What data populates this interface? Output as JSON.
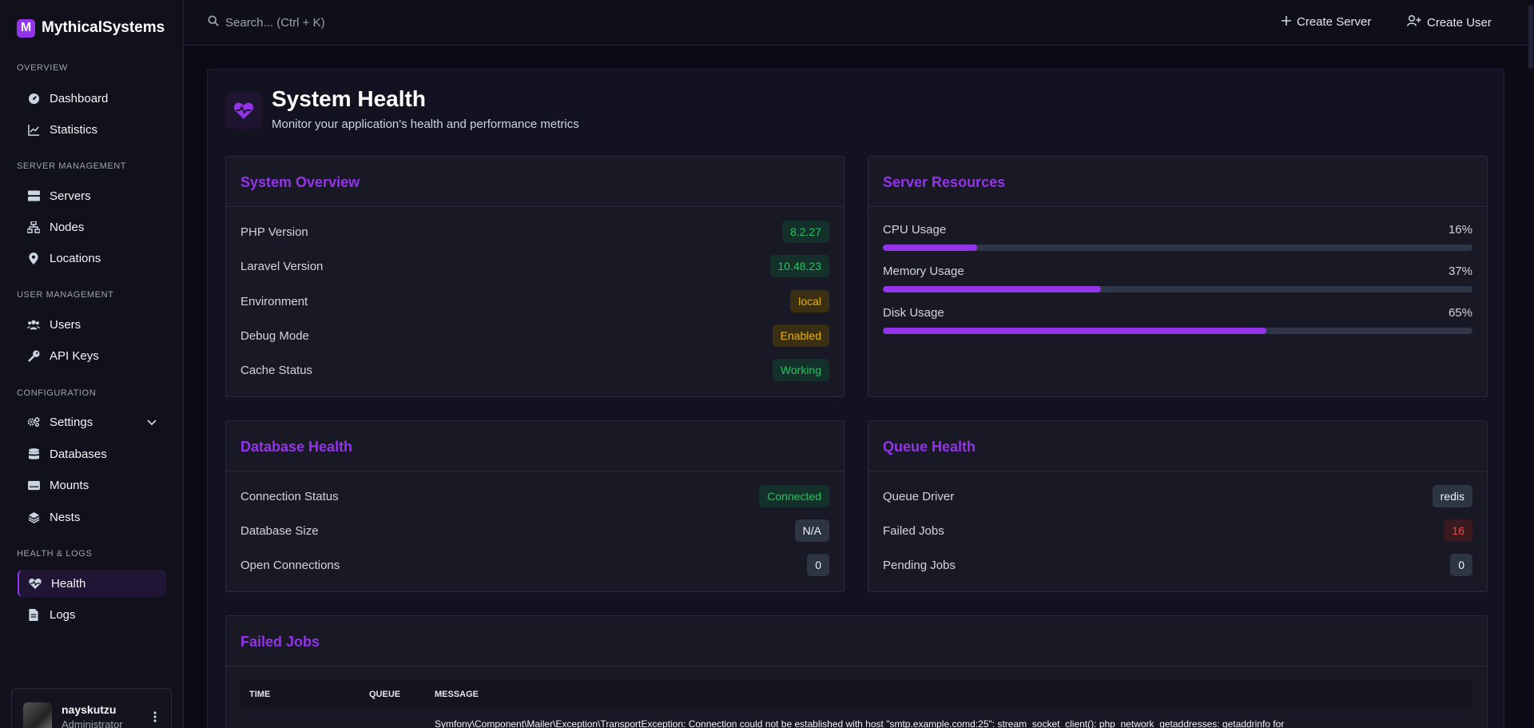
{
  "brand": {
    "logo_letter": "M",
    "name": "MythicalSystems",
    "accent": "#9333ea"
  },
  "sidebar": {
    "sections": [
      {
        "title": "OVERVIEW",
        "items": [
          {
            "label": "Dashboard",
            "icon": "dashboard-icon"
          },
          {
            "label": "Statistics",
            "icon": "chart-line-icon"
          }
        ]
      },
      {
        "title": "SERVER MANAGEMENT",
        "items": [
          {
            "label": "Servers",
            "icon": "server-icon"
          },
          {
            "label": "Nodes",
            "icon": "network-icon"
          },
          {
            "label": "Locations",
            "icon": "map-pin-icon"
          }
        ]
      },
      {
        "title": "USER MANAGEMENT",
        "items": [
          {
            "label": "Users",
            "icon": "users-icon"
          },
          {
            "label": "API Keys",
            "icon": "key-icon"
          }
        ]
      },
      {
        "title": "CONFIGURATION",
        "items": [
          {
            "label": "Settings",
            "icon": "gears-icon"
          },
          {
            "label": "Databases",
            "icon": "database-icon"
          },
          {
            "label": "Mounts",
            "icon": "hard-drive-icon"
          },
          {
            "label": "Nests",
            "icon": "layers-icon"
          }
        ]
      },
      {
        "title": "HEALTH & LOGS",
        "items": [
          {
            "label": "Health",
            "icon": "heart-pulse-icon",
            "active": true
          },
          {
            "label": "Logs",
            "icon": "file-icon"
          }
        ]
      }
    ]
  },
  "user": {
    "name": "nayskutzu",
    "role": "Administrator"
  },
  "topbar": {
    "search_placeholder": "Search... (Ctrl + K)",
    "create_server": "Create Server",
    "create_user": "Create User"
  },
  "page": {
    "title": "System Health",
    "subtitle": "Monitor your application's health and performance metrics"
  },
  "system_overview": {
    "title": "System Overview",
    "rows": [
      {
        "label": "PHP Version",
        "value": "8.2.27",
        "color": "green"
      },
      {
        "label": "Laravel Version",
        "value": "10.48.23",
        "color": "green"
      },
      {
        "label": "Environment",
        "value": "local",
        "color": "yellow"
      },
      {
        "label": "Debug Mode",
        "value": "Enabled",
        "color": "yellow"
      },
      {
        "label": "Cache Status",
        "value": "Working",
        "color": "green"
      }
    ]
  },
  "server_resources": {
    "title": "Server Resources",
    "items": [
      {
        "label": "CPU Usage",
        "value": "16%",
        "percent": 16
      },
      {
        "label": "Memory Usage",
        "value": "37%",
        "percent": 37
      },
      {
        "label": "Disk Usage",
        "value": "65%",
        "percent": 65
      }
    ]
  },
  "database_health": {
    "title": "Database Health",
    "rows": [
      {
        "label": "Connection Status",
        "value": "Connected",
        "color": "green"
      },
      {
        "label": "Database Size",
        "value": "N/A",
        "color": "gray"
      },
      {
        "label": "Open Connections",
        "value": "0",
        "color": "gray"
      }
    ]
  },
  "queue_health": {
    "title": "Queue Health",
    "rows": [
      {
        "label": "Queue Driver",
        "value": "redis",
        "color": "gray"
      },
      {
        "label": "Failed Jobs",
        "value": "16",
        "color": "red"
      },
      {
        "label": "Pending Jobs",
        "value": "0",
        "color": "gray"
      }
    ]
  },
  "failed_jobs": {
    "title": "Failed Jobs",
    "columns": [
      "TIME",
      "QUEUE",
      "MESSAGE"
    ],
    "first_message": "Symfony\\Component\\Mailer\\Exception\\TransportException: Connection could not be established with host \"smtp.example.comd:25\": stream_socket_client(): php_network_getaddresses: getaddrinfo for"
  }
}
